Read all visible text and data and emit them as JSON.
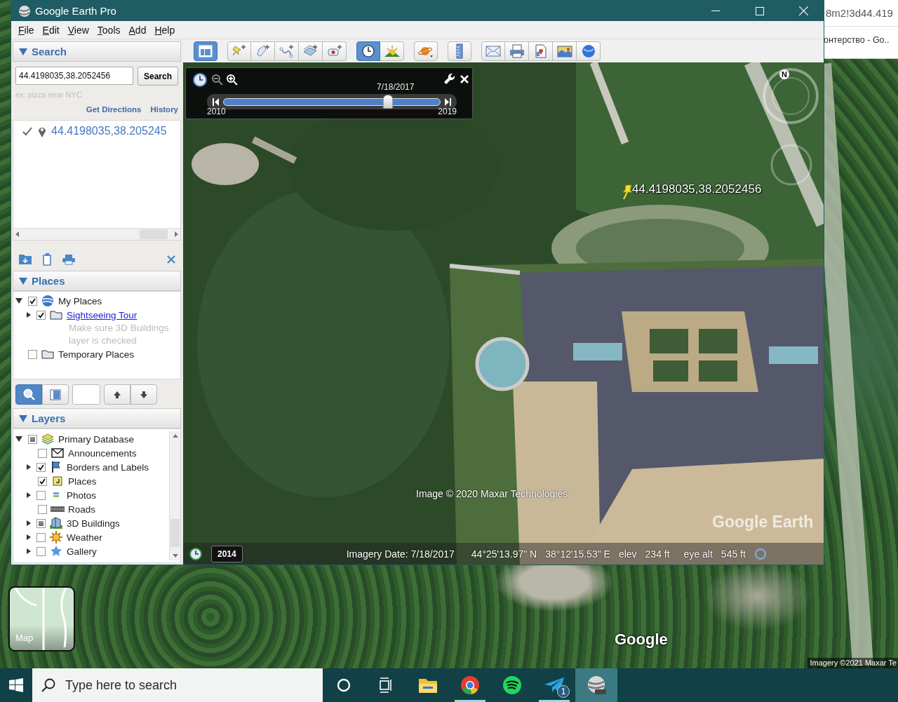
{
  "browser": {
    "address_fragment": "8m2!3d44.419",
    "tab_fragment": "онтерство - Go.."
  },
  "maps": {
    "layer_button": "Map",
    "logo": "Google",
    "attribution": "Imagery ©2021 Maxar Te"
  },
  "window": {
    "title": "Google Earth Pro"
  },
  "menu": [
    "File",
    "Edit",
    "View",
    "Tools",
    "Add",
    "Help"
  ],
  "search_panel": {
    "title": "Search",
    "expanded": true,
    "query": "44.4198035,38.2052456",
    "button": "Search",
    "hint": "ex: pizza near NYC",
    "links": [
      "Get Directions",
      "History"
    ],
    "results": [
      {
        "text": "44.4198035,38.205245",
        "checked": true
      }
    ]
  },
  "places_panel": {
    "title": "Places",
    "expanded": true,
    "items": [
      {
        "label": "My Places",
        "kind": "globe",
        "checked": true,
        "expanded": true,
        "children": [
          {
            "label": "Sightseeing Tour",
            "kind": "folder",
            "link": true,
            "checked": true,
            "expanded": false,
            "description": "Make sure 3D Buildings layer is checked"
          }
        ]
      },
      {
        "label": "Temporary Places",
        "kind": "folder",
        "checked": false
      }
    ]
  },
  "places_buttons": [
    {
      "kind": "search",
      "selected": true
    },
    {
      "kind": "panel",
      "selected": false
    }
  ],
  "layers_panel": {
    "title": "Layers",
    "expanded": true,
    "items": [
      {
        "label": "Primary Database",
        "kind": "database",
        "checked": false,
        "partial": true,
        "expanded": true,
        "children": [
          {
            "label": "Announcements",
            "kind": "envelope",
            "checked": false
          },
          {
            "label": "Borders and Labels",
            "kind": "flag",
            "checked": true,
            "expanded": false
          },
          {
            "label": "Places",
            "kind": "places",
            "checked": true
          },
          {
            "label": "Photos",
            "kind": "photos",
            "checked": false,
            "expanded": false
          },
          {
            "label": "Roads",
            "kind": "roads",
            "checked": false
          },
          {
            "label": "3D Buildings",
            "kind": "buildings",
            "checked": false,
            "partial": true,
            "expanded": false
          },
          {
            "label": "Weather",
            "kind": "weather",
            "checked": false,
            "expanded": false
          },
          {
            "label": "Gallery",
            "kind": "gallery",
            "checked": false,
            "expanded": false
          }
        ]
      }
    ]
  },
  "toolbar": [
    [
      {
        "kind": "sidebar",
        "selected": true
      }
    ],
    [
      {
        "kind": "placemark",
        "selected": false
      },
      {
        "kind": "polygon",
        "selected": false
      },
      {
        "kind": "path",
        "selected": false
      },
      {
        "kind": "overlay",
        "selected": false
      },
      {
        "kind": "tour",
        "selected": false
      }
    ],
    [
      {
        "kind": "history",
        "selected": true
      },
      {
        "kind": "sunlight",
        "selected": false
      }
    ],
    [
      {
        "kind": "planets",
        "selected": false
      }
    ],
    [
      {
        "kind": "ruler",
        "selected": false
      }
    ],
    [
      {
        "kind": "email",
        "selected": false
      },
      {
        "kind": "print",
        "selected": false
      },
      {
        "kind": "maps",
        "selected": false
      },
      {
        "kind": "image",
        "selected": false
      },
      {
        "kind": "earth",
        "selected": false
      }
    ]
  ],
  "time_slider": {
    "date": "7/18/2017",
    "start": "2010",
    "end": "2019",
    "level": 0.76
  },
  "view": {
    "placemark_label": "44.4198035,38.2052456",
    "compass_north": "N",
    "attribution": "Image © 2020 Maxar Technologies",
    "logo": "Google Earth"
  },
  "status_bar": {
    "year": "2014",
    "imagery_date": "Imagery Date: 7/18/2017",
    "latitude": "44°25'13.97\" N",
    "longitude": "38°12'15.53\" E",
    "elev_label": "elev",
    "elev": "234 ft",
    "eye_label": "eye alt",
    "eye": "545 ft"
  },
  "taskbar": {
    "search_placeholder": "Type here to search",
    "apps": [
      {
        "kind": "cortana",
        "running": false,
        "active": false
      },
      {
        "kind": "taskview",
        "running": false,
        "active": false
      },
      {
        "kind": "explorer",
        "running": false,
        "active": false
      },
      {
        "kind": "chrome",
        "running": true,
        "active": false
      },
      {
        "kind": "spotify",
        "running": false,
        "active": false
      },
      {
        "kind": "telegram",
        "running": true,
        "active": false,
        "badge": "1"
      },
      {
        "kind": "earth",
        "running": false,
        "active": true
      }
    ]
  }
}
